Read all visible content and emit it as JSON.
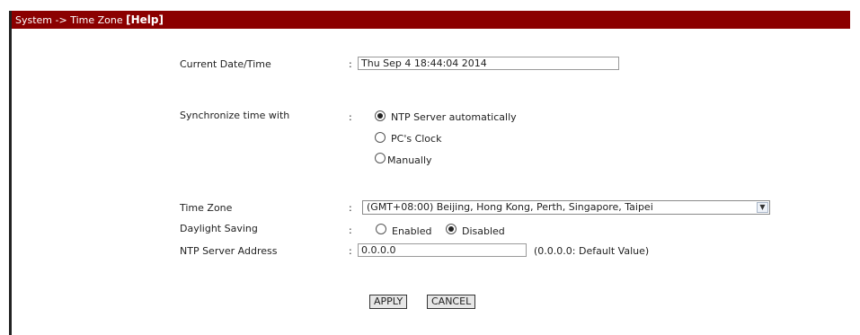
{
  "title": {
    "breadcrumb": "System -> Time Zone",
    "help_link": "[Help]"
  },
  "colon": ":",
  "current_datetime": {
    "label": "Current Date/Time",
    "value": "Thu Sep  4 18:44:04 2014"
  },
  "sync": {
    "label": "Synchronize time with",
    "options": [
      {
        "label": "NTP Server automatically",
        "selected": true
      },
      {
        "label": "PC's Clock",
        "selected": false
      },
      {
        "label": "Manually",
        "selected": false
      }
    ]
  },
  "time_zone": {
    "label": "Time Zone",
    "selected": "(GMT+08:00) Beijing, Hong Kong, Perth, Singapore, Taipei"
  },
  "daylight_saving": {
    "label": "Daylight Saving",
    "options": [
      {
        "label": "Enabled",
        "selected": false
      },
      {
        "label": "Disabled",
        "selected": true
      }
    ]
  },
  "ntp_server": {
    "label": "NTP Server Address",
    "value": "0.0.0.0",
    "hint": "(0.0.0.0: Default Value)"
  },
  "buttons": {
    "apply": "APPLY",
    "cancel": "CANCEL"
  },
  "colors": {
    "title_bar": "#8b0000",
    "title_text": "#ffffff"
  }
}
